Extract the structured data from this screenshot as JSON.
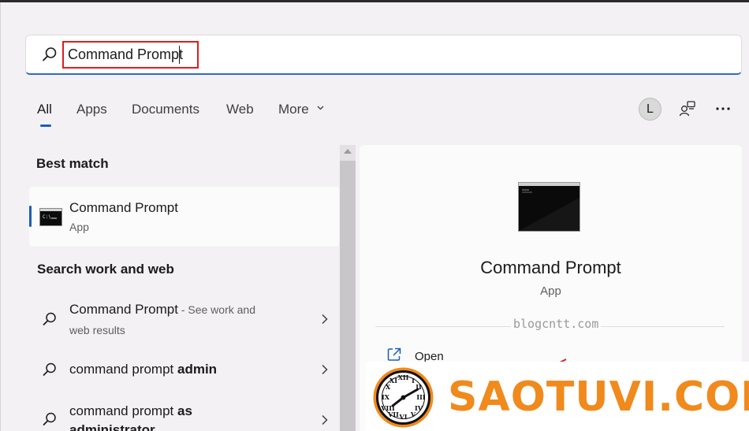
{
  "search": {
    "value": "Command Prompt",
    "icon": "search-icon"
  },
  "tabs": [
    {
      "label": "All",
      "active": true
    },
    {
      "label": "Apps",
      "active": false
    },
    {
      "label": "Documents",
      "active": false
    },
    {
      "label": "Web",
      "active": false
    },
    {
      "label": "More",
      "active": false
    }
  ],
  "header": {
    "avatar_letter": "L"
  },
  "best_match": {
    "section_title": "Best match",
    "name": "Command Prompt",
    "type": "App"
  },
  "search_web": {
    "section_title": "Search work and web",
    "items": [
      {
        "text": "Command Prompt",
        "suffix": " - See work and",
        "second_line": "web results"
      },
      {
        "text_plain": "command prompt ",
        "text_bold": "admin"
      },
      {
        "text_plain": "command prompt ",
        "text_bold": "as",
        "second_line_bold": "administrator"
      }
    ]
  },
  "detail": {
    "title": "Command Prompt",
    "type": "App",
    "actions": [
      {
        "label": "Open",
        "icon": "open-external-icon"
      }
    ]
  },
  "watermarks": {
    "blog": "blogcntt.com",
    "logo": "SAOTUVI.COM"
  },
  "colors": {
    "accent": "#1a5fb4",
    "highlight_border": "#e01c1c",
    "logo_orange": "#f08a1c"
  }
}
